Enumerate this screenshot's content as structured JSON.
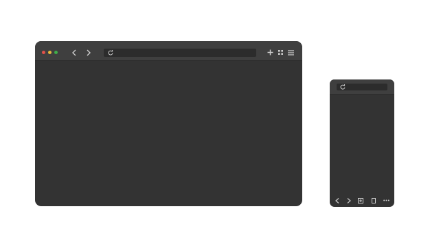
{
  "desktop_browser": {
    "window_controls": [
      "close",
      "minimize",
      "maximize"
    ],
    "window_control_colors": {
      "close": "#e2514a",
      "minimize": "#e7b73b",
      "maximize": "#3fae4a"
    },
    "nav_icons": [
      "chevron-left-icon",
      "chevron-right-icon"
    ],
    "address_bar_icon": "reload-icon",
    "address_bar_value": "",
    "toolbar_right_icons": [
      "plus-icon",
      "grid-icon",
      "menu-icon"
    ]
  },
  "mobile_browser": {
    "address_bar_icon": "reload-icon",
    "address_bar_value": "",
    "bottom_icons": [
      "chevron-left-icon",
      "chevron-right-icon",
      "plus-square-icon",
      "tabs-icon",
      "more-icon"
    ]
  },
  "colors": {
    "frame": "#333333",
    "toolbar": "#3f3f3f",
    "address_bar": "#2c2c2c",
    "icon": "#cfcfcf"
  }
}
